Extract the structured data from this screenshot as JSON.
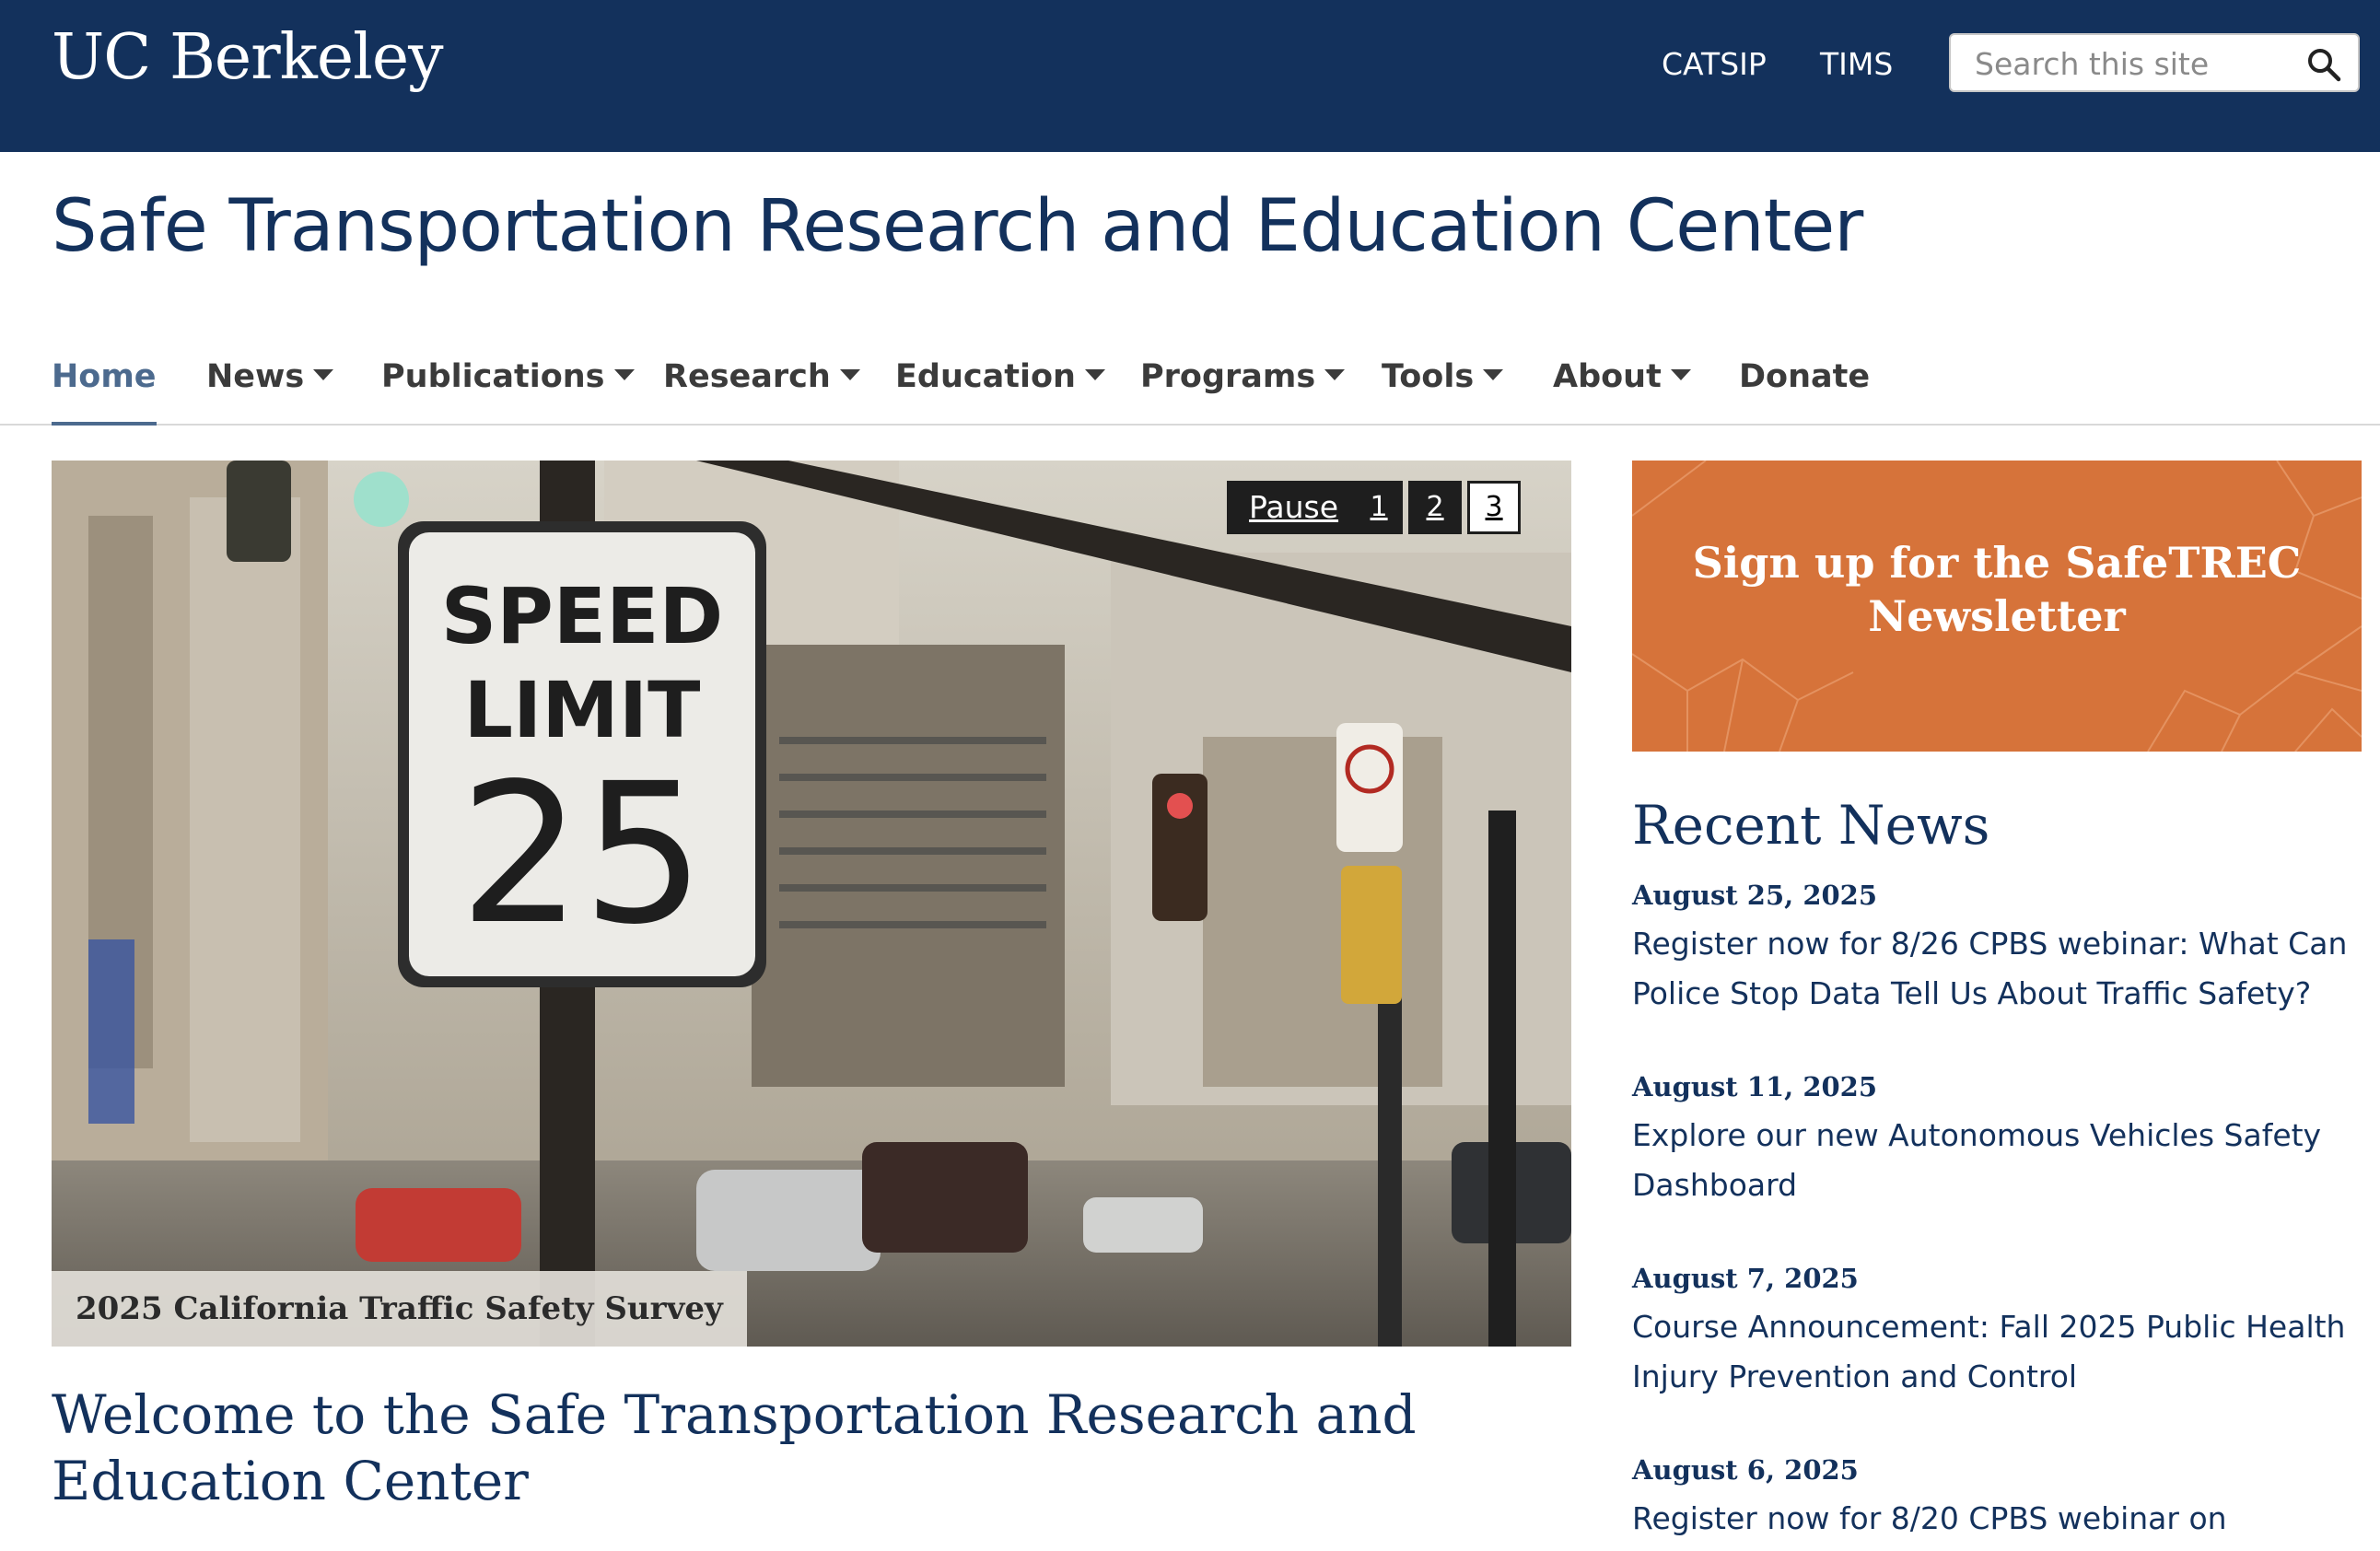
{
  "header": {
    "logo": "UC Berkeley",
    "links": [
      "CATSIP",
      "TIMS"
    ],
    "search_placeholder": "Search this site"
  },
  "site_title": "Safe Transportation Research and Education Center",
  "nav": {
    "items": [
      "Home",
      "News",
      "Publications",
      "Research",
      "Education",
      "Programs",
      "Tools",
      "About",
      "Donate"
    ],
    "active": "Home"
  },
  "slideshow": {
    "pause_label": "Pause",
    "slides": [
      "1",
      "2",
      "3"
    ],
    "current_slide": "3",
    "caption": "2025 California Traffic Safety Survey",
    "sign": {
      "line1": "SPEED",
      "line2": "LIMIT",
      "line3": "25"
    }
  },
  "welcome_heading": "Welcome to the Safe Transportation Research and Education Center",
  "newsletter": {
    "text": "Sign up for the SafeTREC Newsletter"
  },
  "recent_news": {
    "title": "Recent News",
    "items": [
      {
        "date": "August 25, 2025",
        "title": "Register now for 8/26 CPBS webinar: What Can Police Stop Data Tell Us About Traffic Safety?"
      },
      {
        "date": "August 11, 2025",
        "title": "Explore our new Autonomous Vehicles Safety Dashboard"
      },
      {
        "date": "August 7, 2025",
        "title": "Course Announcement: Fall 2025 Public Health Injury Prevention and Control"
      },
      {
        "date": "August 6, 2025",
        "title": "Register now for 8/20 CPBS webinar on"
      }
    ]
  },
  "colors": {
    "brand_navy": "#13315c",
    "accent_orange": "#d6733a",
    "nav_active": "#4c6a8e"
  }
}
